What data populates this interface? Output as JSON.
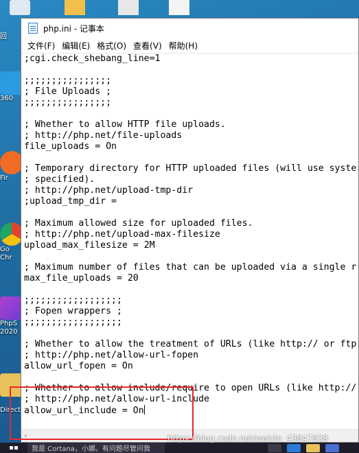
{
  "window": {
    "title": "php.ini - 记事本"
  },
  "menu": [
    "文件(F)",
    "编辑(E)",
    "格式(O)",
    "查看(V)",
    "帮助(H)"
  ],
  "editor": {
    "lines": [
      ";cgi.check_shebang_line=1",
      "",
      ";;;;;;;;;;;;;;;;",
      "; File Uploads ;",
      ";;;;;;;;;;;;;;;;",
      "",
      "; Whether to allow HTTP file uploads.",
      "; http://php.net/file-uploads",
      "file_uploads = On",
      "",
      "; Temporary directory for HTTP uploaded files (will use syste",
      "; specified).",
      "; http://php.net/upload-tmp-dir",
      ";upload_tmp_dir =",
      "",
      "; Maximum allowed size for uploaded files.",
      "; http://php.net/upload-max-filesize",
      "upload_max_filesize = 2M",
      "",
      "; Maximum number of files that can be uploaded via a single r",
      "max_file_uploads = 20",
      "",
      ";;;;;;;;;;;;;;;;;;",
      "; Fopen wrappers ;",
      ";;;;;;;;;;;;;;;;;;",
      "",
      "; Whether to allow the treatment of URLs (like http:// or ftp",
      "; http://php.net/allow-url-fopen",
      "allow_url_fopen = On",
      "",
      "; Whether to allow include/require to open URLs (like http://",
      "; http://php.net/allow-url-include",
      "allow_url_include = On"
    ]
  },
  "desktop": {
    "icons": [
      {
        "label": "回",
        "color": "#d9e6f2"
      },
      {
        "label": "360",
        "color": "#2b9be0"
      },
      {
        "label": "Fir",
        "color": "#f06b24"
      },
      {
        "label": "Go",
        "label2": "Chr",
        "color": "#e0432f"
      },
      {
        "label": "PhpS",
        "label2": "2020",
        "color": "#b03fd1"
      },
      {
        "label": "Direct",
        "color": "#e9c15a"
      }
    ]
  },
  "watermark": "https://blog.csdn.net/weixin_43847838",
  "taskbar": {
    "search_text": "我是 Cortana，小娜。有问题尽管问我"
  },
  "colors": {
    "highlight": "#e8272b",
    "desktop_bg": "#1e6aa0"
  }
}
